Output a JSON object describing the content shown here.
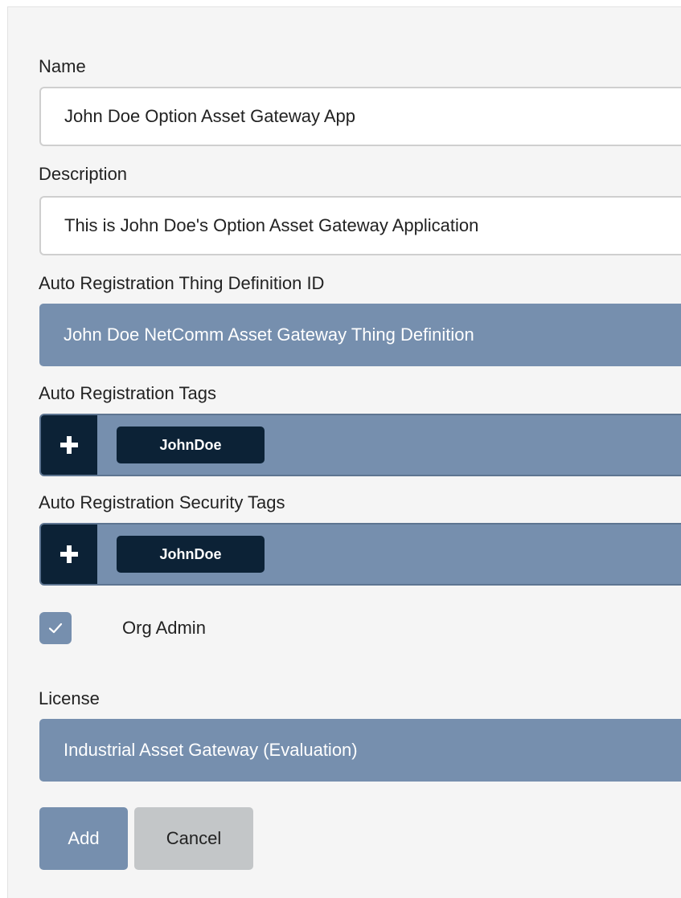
{
  "form": {
    "name": {
      "label": "Name",
      "value": "John Doe Option Asset Gateway App"
    },
    "description": {
      "label": "Description",
      "value": "This is John Doe's Option Asset Gateway Application"
    },
    "thing_definition": {
      "label": "Auto Registration Thing Definition ID",
      "selected": "John Doe NetComm Asset Gateway Thing Definition"
    },
    "tags": {
      "label": "Auto Registration Tags",
      "items": [
        "JohnDoe"
      ]
    },
    "security_tags": {
      "label": "Auto Registration Security Tags",
      "items": [
        "JohnDoe"
      ]
    },
    "org_admin": {
      "label": "Org Admin",
      "checked": true
    },
    "license": {
      "label": "License",
      "selected": "Industrial Asset Gateway (Evaluation)"
    }
  },
  "actions": {
    "add_label": "Add",
    "cancel_label": "Cancel"
  },
  "icons": {
    "add_tag": "plus-icon",
    "checkbox": "check-icon"
  },
  "colors": {
    "accent": "#768fae",
    "dark": "#0c2236",
    "panel_bg": "#f5f5f5",
    "cancel_bg": "#c3c6c8"
  }
}
